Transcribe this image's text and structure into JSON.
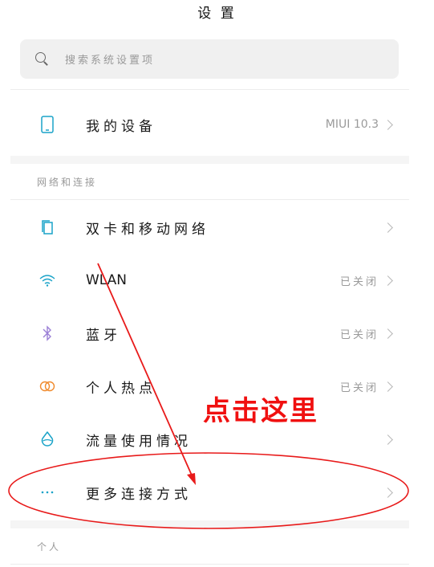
{
  "header": {
    "title": "设 置"
  },
  "search": {
    "placeholder": "搜索系统设置项"
  },
  "device": {
    "label": "我的设备",
    "version": "MIUI 10.3"
  },
  "network_section": {
    "header": "网络和连接",
    "items": [
      {
        "label": "双卡和移动网络",
        "value": "",
        "icon": "sim-card-icon"
      },
      {
        "label": "WLAN",
        "value": "已关闭",
        "icon": "wifi-icon"
      },
      {
        "label": "蓝牙",
        "value": "已关闭",
        "icon": "bluetooth-icon"
      },
      {
        "label": "个人热点",
        "value": "已关闭",
        "icon": "hotspot-icon"
      },
      {
        "label": "流量使用情况",
        "value": "",
        "icon": "data-usage-icon"
      },
      {
        "label": "更多连接方式",
        "value": "",
        "icon": "more-dots-icon"
      }
    ]
  },
  "personal_section": {
    "header": "个人"
  },
  "annotation": {
    "text": "点击这里",
    "color": "#f01010"
  },
  "colors": {
    "accent": "#1aa3c8",
    "bluetooth": "#9b7fd6",
    "hotspot": "#f08a2c"
  }
}
